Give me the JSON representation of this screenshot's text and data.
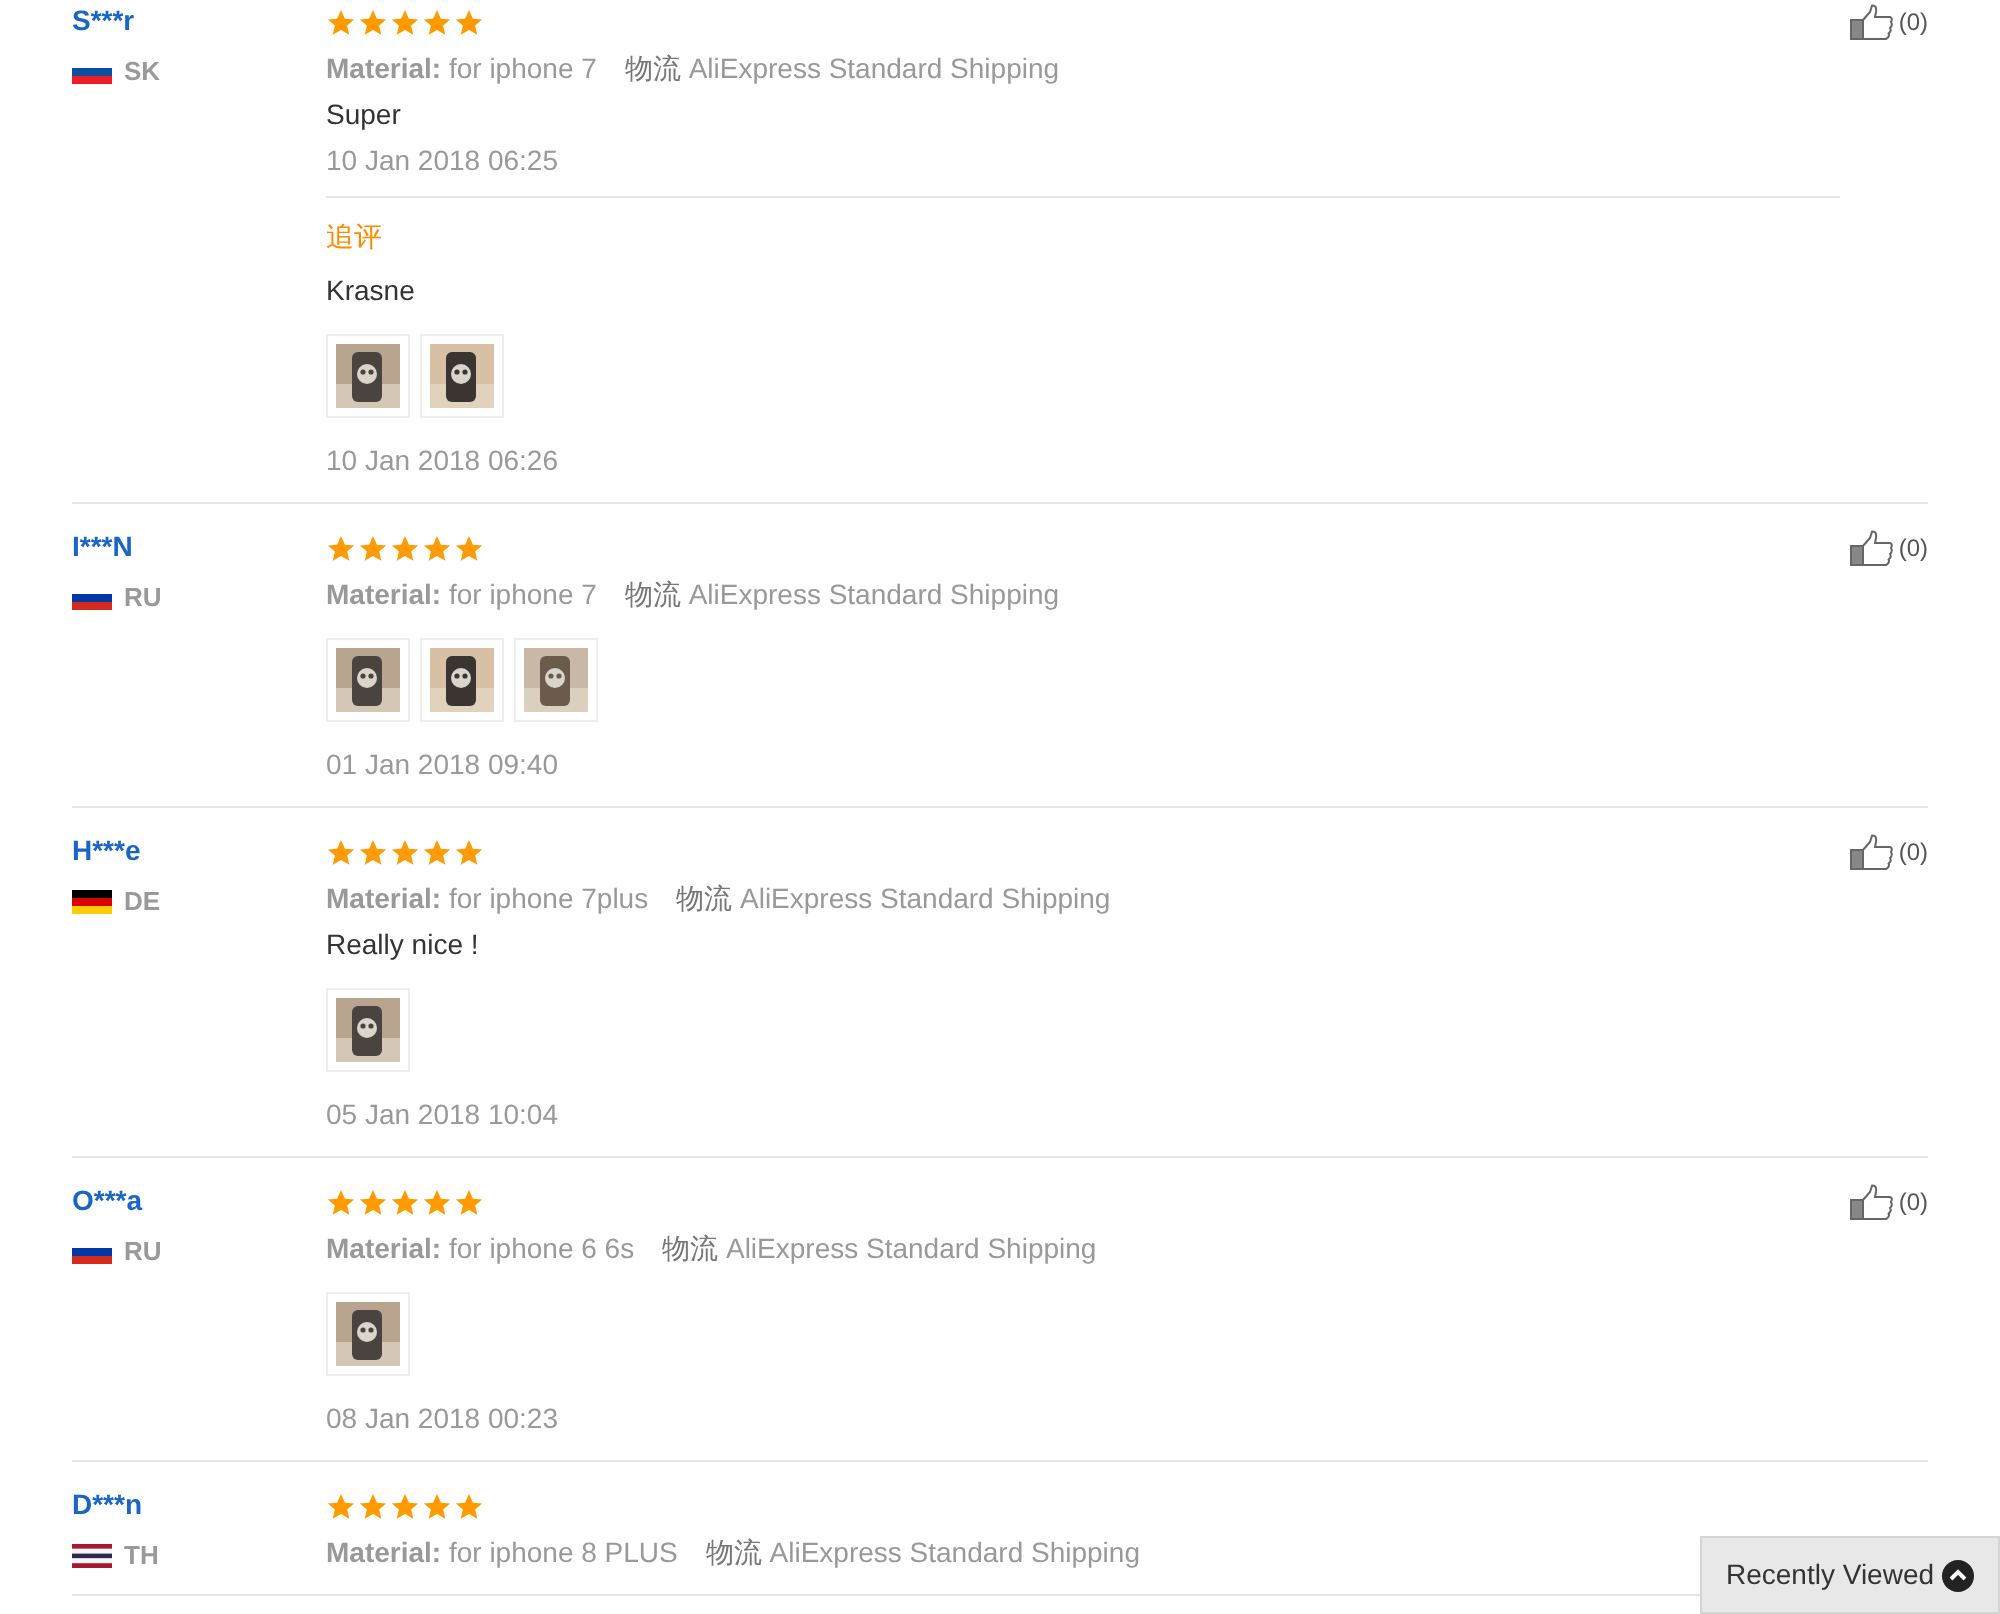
{
  "reviews": [
    {
      "name": "S***r",
      "country": "SK",
      "flag": [
        {
          "color": "#ffffff"
        },
        {
          "color": "#0b4ea2"
        },
        {
          "color": "#ee1c25"
        }
      ],
      "stars": 5,
      "material_label": "Material:",
      "material": "for iphone 7",
      "shipping_label": "物流",
      "shipping": "AliExpress Standard Shipping",
      "text": "Super",
      "date": "10 Jan 2018 06:25",
      "likes": "(0)",
      "followup": {
        "label": "追评",
        "text": "Krasne",
        "photos": [
          {
            "kind": "picture"
          },
          {
            "kind": "picture"
          }
        ],
        "date": "10 Jan 2018 06:26"
      }
    },
    {
      "name": "I***N",
      "country": "RU",
      "flag": [
        {
          "color": "#ffffff"
        },
        {
          "color": "#0039a6"
        },
        {
          "color": "#d52b1e"
        }
      ],
      "stars": 5,
      "material_label": "Material:",
      "material": "for iphone 7",
      "shipping_label": "物流",
      "shipping": "AliExpress Standard Shipping",
      "photos": [
        {
          "kind": "picture"
        },
        {
          "kind": "picture"
        },
        {
          "kind": "picture"
        }
      ],
      "date": "01 Jan 2018 09:40",
      "likes": "(0)"
    },
    {
      "name": "H***e",
      "country": "DE",
      "flag": [
        {
          "color": "#000000"
        },
        {
          "color": "#dd0000"
        },
        {
          "color": "#ffce00"
        }
      ],
      "stars": 5,
      "material_label": "Material:",
      "material": "for iphone 7plus",
      "shipping_label": "物流",
      "shipping": "AliExpress Standard Shipping",
      "text": "Really nice !",
      "photos": [
        {
          "kind": "picture"
        }
      ],
      "date": "05 Jan 2018 10:04",
      "likes": "(0)"
    },
    {
      "name": "O***a",
      "country": "RU",
      "flag": [
        {
          "color": "#ffffff"
        },
        {
          "color": "#0039a6"
        },
        {
          "color": "#d52b1e"
        }
      ],
      "stars": 5,
      "material_label": "Material:",
      "material": "for iphone 6 6s",
      "shipping_label": "物流",
      "shipping": "AliExpress Standard Shipping",
      "photos": [
        {
          "kind": "picture"
        }
      ],
      "date": "08 Jan 2018 00:23",
      "likes": "(0)"
    },
    {
      "name": "D***n",
      "country": "TH",
      "flag": [
        {
          "color": "#a51931"
        },
        {
          "color": "#f4f5f8"
        },
        {
          "color": "#2d2a4a"
        },
        {
          "color": "#f4f5f8"
        },
        {
          "color": "#a51931"
        }
      ],
      "stars": 5,
      "material_label": "Material:",
      "material": "for iphone 8 PLUS",
      "shipping_label": "物流",
      "shipping": "AliExpress Standard Shipping"
    }
  ],
  "recently_viewed": {
    "label": "Recently Viewed"
  }
}
